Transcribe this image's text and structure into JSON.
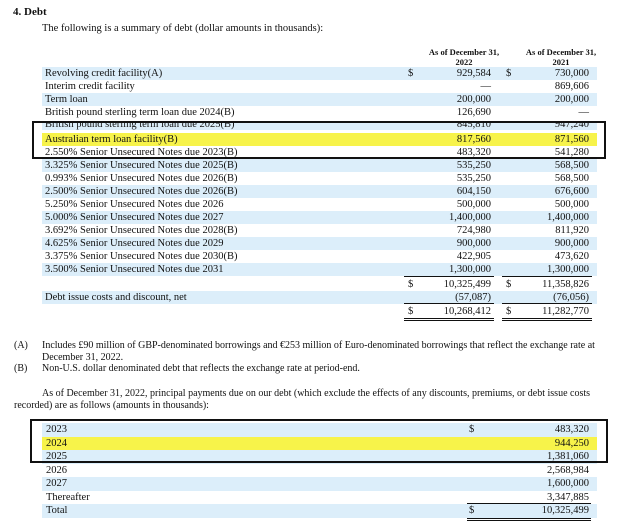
{
  "section_title": "4. Debt",
  "intro": "The following is a summary of debt (dollar amounts in thousands):",
  "columns": {
    "c2022": [
      "As of December 31,",
      "2022"
    ],
    "c2021": [
      "As of December 31,",
      "2021"
    ]
  },
  "debt_rows": [
    {
      "label": "Revolving credit facility(A)",
      "cur1": "$",
      "v2022": "929,584",
      "cur2": "$",
      "v2021": "730,000"
    },
    {
      "label": "Interim credit facility",
      "cur1": "",
      "v2022": "—",
      "cur2": "",
      "v2021": "869,606"
    },
    {
      "label": "Term loan",
      "cur1": "",
      "v2022": "200,000",
      "cur2": "",
      "v2021": "200,000"
    },
    {
      "label": "British pound sterling term loan due 2024(B)",
      "cur1": "",
      "v2022": "126,690",
      "cur2": "",
      "v2021": "—"
    },
    {
      "label": "British pound sterling term loan due 2025(B)",
      "cur1": "",
      "v2022": "845,810",
      "cur2": "",
      "v2021": "947,240"
    },
    {
      "label": "Australian term loan facility(B)",
      "cur1": "",
      "v2022": "817,560",
      "cur2": "",
      "v2021": "871,560"
    },
    {
      "label": "2.550% Senior Unsecured Notes due 2023(B)",
      "cur1": "",
      "v2022": "483,320",
      "cur2": "",
      "v2021": "541,280"
    },
    {
      "label": "3.325% Senior Unsecured Notes due 2025(B)",
      "cur1": "",
      "v2022": "535,250",
      "cur2": "",
      "v2021": "568,500"
    },
    {
      "label": "0.993% Senior Unsecured Notes due 2026(B)",
      "cur1": "",
      "v2022": "535,250",
      "cur2": "",
      "v2021": "568,500"
    },
    {
      "label": "2.500% Senior Unsecured Notes due 2026(B)",
      "cur1": "",
      "v2022": "604,150",
      "cur2": "",
      "v2021": "676,600"
    },
    {
      "label": "5.250% Senior Unsecured Notes due 2026",
      "cur1": "",
      "v2022": "500,000",
      "cur2": "",
      "v2021": "500,000"
    },
    {
      "label": "5.000% Senior Unsecured Notes due 2027",
      "cur1": "",
      "v2022": "1,400,000",
      "cur2": "",
      "v2021": "1,400,000"
    },
    {
      "label": "3.692% Senior Unsecured Notes due 2028(B)",
      "cur1": "",
      "v2022": "724,980",
      "cur2": "",
      "v2021": "811,920"
    },
    {
      "label": "4.625% Senior Unsecured Notes due 2029",
      "cur1": "",
      "v2022": "900,000",
      "cur2": "",
      "v2021": "900,000"
    },
    {
      "label": "3.375% Senior Unsecured Notes due 2030(B)",
      "cur1": "",
      "v2022": "422,905",
      "cur2": "",
      "v2021": "473,620"
    },
    {
      "label": "3.500% Senior Unsecured Notes due 2031",
      "cur1": "",
      "v2022": "1,300,000",
      "cur2": "",
      "v2021": "1,300,000"
    },
    {
      "label": "",
      "cur1": "$",
      "v2022": "10,325,499",
      "cur2": "$",
      "v2021": "11,358,826"
    },
    {
      "label": "Debt issue costs and discount, net",
      "cur1": "",
      "v2022": "(57,087)",
      "cur2": "",
      "v2021": "(76,056)"
    },
    {
      "label": "",
      "cur1": "$",
      "v2022": "10,268,412",
      "cur2": "$",
      "v2021": "11,282,770"
    }
  ],
  "footnotes": [
    {
      "mark": "(A)",
      "text": "Includes £90 million of GBP-denominated borrowings and €253 million of Euro-denominated borrowings that reflect the exchange rate at December 31, 2022."
    },
    {
      "mark": "(B)",
      "text": "Non-U.S. dollar denominated debt that reflects the exchange rate at period-end."
    }
  ],
  "payments_intro": "As of December 31, 2022, principal payments due on our debt (which exclude the effects of any discounts, premiums, or debt issue costs recorded) are as follows (amounts in thousands):",
  "payments": [
    {
      "year": "2023",
      "cur": "$",
      "amount": "483,320"
    },
    {
      "year": "2024",
      "cur": "",
      "amount": "944,250"
    },
    {
      "year": "2025",
      "cur": "",
      "amount": "1,381,060"
    },
    {
      "year": "2026",
      "cur": "",
      "amount": "2,568,984"
    },
    {
      "year": "2027",
      "cur": "",
      "amount": "1,600,000"
    },
    {
      "year": "Thereafter",
      "cur": "",
      "amount": "3,347,885"
    },
    {
      "year": "Total",
      "cur": "$",
      "amount": "10,325,499"
    }
  ]
}
